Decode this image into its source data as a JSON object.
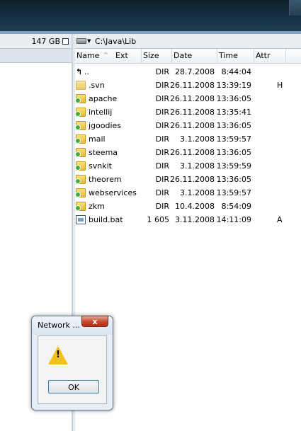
{
  "left_panel": {
    "free_space": "147 GB"
  },
  "right_panel": {
    "path": "C:\\Java\\Lib",
    "columns": [
      "Name",
      "Ext",
      "Size",
      "Date",
      "Time",
      "Attr"
    ],
    "rows": [
      {
        "name": "..",
        "size": "DIR",
        "date": "28.7.2008",
        "time": "8:44:04",
        "attr": "",
        "icon": "up-arrow-icon"
      },
      {
        "name": ".svn",
        "size": "DIR",
        "date": "26.11.2008",
        "time": "13:39:19",
        "attr": "H",
        "icon": "folder-icon"
      },
      {
        "name": "apache",
        "size": "DIR",
        "date": "26.11.2008",
        "time": "13:36:05",
        "attr": "",
        "icon": "svn-folder-icon"
      },
      {
        "name": "intellij",
        "size": "DIR",
        "date": "26.11.2008",
        "time": "13:35:41",
        "attr": "",
        "icon": "svn-folder-icon"
      },
      {
        "name": "jgoodies",
        "size": "DIR",
        "date": "26.11.2008",
        "time": "13:36:05",
        "attr": "",
        "icon": "svn-folder-icon"
      },
      {
        "name": "mail",
        "size": "DIR",
        "date": "3.1.2008",
        "time": "13:59:57",
        "attr": "",
        "icon": "svn-folder-icon"
      },
      {
        "name": "steema",
        "size": "DIR",
        "date": "26.11.2008",
        "time": "13:36:05",
        "attr": "",
        "icon": "svn-folder-icon"
      },
      {
        "name": "svnkit",
        "size": "DIR",
        "date": "3.1.2008",
        "time": "13:59:59",
        "attr": "",
        "icon": "svn-folder-icon"
      },
      {
        "name": "theorem",
        "size": "DIR",
        "date": "26.11.2008",
        "time": "13:36:05",
        "attr": "",
        "icon": "svn-folder-icon"
      },
      {
        "name": "webservices",
        "size": "DIR",
        "date": "3.1.2008",
        "time": "13:59:57",
        "attr": "",
        "icon": "svn-folder-icon"
      },
      {
        "name": "zkm",
        "size": "DIR",
        "date": "10.4.2008",
        "time": "8:54:09",
        "attr": "",
        "icon": "svn-folder-icon"
      },
      {
        "name": "build.bat",
        "size": "1 605",
        "date": "3.11.2008",
        "time": "14:11:09",
        "attr": "A",
        "icon": "file-icon"
      }
    ]
  },
  "dialog": {
    "title": "Network ...",
    "close_label": "x",
    "ok_label": "OK",
    "icon": "warning-icon"
  }
}
